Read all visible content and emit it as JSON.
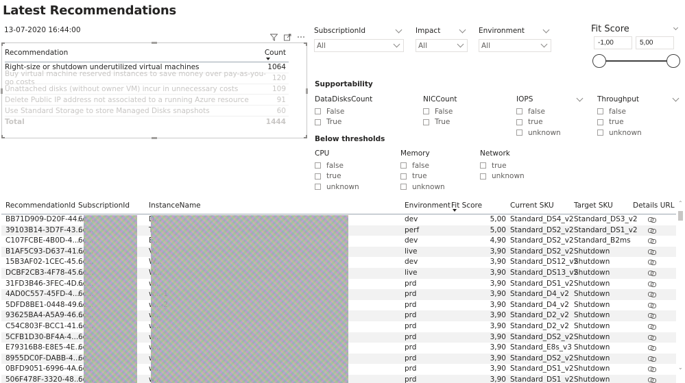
{
  "title": "Latest Recommendations",
  "timestamp": "13-07-2020 16:44:00",
  "visual_header_icons": [
    "filter-icon",
    "focus-mode-icon",
    "more-options-icon"
  ],
  "recommendations": {
    "columns": [
      "Recommendation",
      "Count"
    ],
    "sorted_by": "Count",
    "rows": [
      {
        "label": "Right-size or shutdown underutilized virtual machines",
        "count": "1064",
        "selected": true
      },
      {
        "label": "Buy virtual machine reserved instances to save money over pay-as-you-go costs",
        "count": "120",
        "selected": false
      },
      {
        "label": "Unattached disks (without owner VM) incur in unnecessary costs",
        "count": "109",
        "selected": false
      },
      {
        "label": "Delete Public IP address not associated to a running Azure resource",
        "count": "91",
        "selected": false
      },
      {
        "label": "Use Standard Storage to store Managed Disks snapshots",
        "count": "60",
        "selected": false
      }
    ],
    "total_label": "Total",
    "total": "1444"
  },
  "slicers": {
    "subscription": {
      "label": "SubscriptionId",
      "value": "All"
    },
    "impact": {
      "label": "Impact",
      "value": "All"
    },
    "environment": {
      "label": "Environment",
      "value": "All"
    },
    "fit_score": {
      "label": "Fit Score",
      "min": "-1,00",
      "max": "5,00",
      "range_selected": [
        -1.0,
        5.0
      ]
    }
  },
  "supportability": {
    "title": "Supportability",
    "groups": [
      {
        "label": "DataDisksCount",
        "options": [
          "False",
          "True"
        ],
        "has_chevron": false
      },
      {
        "label": "NICCount",
        "options": [
          "False",
          "True"
        ],
        "has_chevron": false
      },
      {
        "label": "IOPS",
        "options": [
          "false",
          "true",
          "unknown"
        ],
        "has_chevron": true
      },
      {
        "label": "Throughput",
        "options": [
          "false",
          "true",
          "unknown"
        ],
        "has_chevron": true
      }
    ]
  },
  "below_thresholds": {
    "title": "Below thresholds",
    "groups": [
      {
        "label": "CPU",
        "options": [
          "false",
          "true",
          "unknown"
        ]
      },
      {
        "label": "Memory",
        "options": [
          "false",
          "true",
          "unknown"
        ]
      },
      {
        "label": "Network",
        "options": [
          "true",
          "unknown"
        ]
      }
    ]
  },
  "grid": {
    "columns": [
      "RecommendationId",
      "SubscriptionId",
      "InstanceName",
      "Environment",
      "Fit Score",
      "Current SKU",
      "Target SKU",
      "Details URL"
    ],
    "sorted_by": "Fit Score",
    "rows": [
      {
        "id": "BB71D909-D20F-44...",
        "sub": "6c...",
        "inst": "D...",
        "env": "dev",
        "fit": "5,00",
        "cur": "Standard_DS4_v2",
        "tgt": "Standard_DS3_v2"
      },
      {
        "id": "39103B14-3D7F-43...",
        "sub": "6c...",
        "inst": "T...",
        "env": "perf",
        "fit": "5,00",
        "cur": "Standard_DS2_v2",
        "tgt": "Standard_DS1_v2"
      },
      {
        "id": "C107FCBE-4B0D-4...",
        "sub": "6c...",
        "inst": "E...",
        "env": "dev",
        "fit": "4,90",
        "cur": "Standard_DS2_v2",
        "tgt": "Standard_B2ms"
      },
      {
        "id": "B1AF5C93-D637-41...",
        "sub": "6c...",
        "inst": "V...",
        "env": "live",
        "fit": "3,90",
        "cur": "Standard_DS2_v2",
        "tgt": "Shutdown"
      },
      {
        "id": "15B3AF02-1CEC-45...",
        "sub": "6c...",
        "inst": "W...",
        "env": "dev",
        "fit": "3,90",
        "cur": "Standard_DS12_v2",
        "tgt": "Shutdown"
      },
      {
        "id": "DCBF2CB3-4F78-45...",
        "sub": "6c...",
        "inst": "W...",
        "env": "live",
        "fit": "3,90",
        "cur": "Standard_DS13_v2",
        "tgt": "Shutdown"
      },
      {
        "id": "31FD3B46-3FEC-4D...",
        "sub": "6c...",
        "inst": "w...",
        "env": "prd",
        "fit": "3,90",
        "cur": "Standard_DS1_v2",
        "tgt": "Shutdown"
      },
      {
        "id": "4AD0C557-45FD-4...",
        "sub": "6c...",
        "inst": "w...-1",
        "env": "prd",
        "fit": "3,90",
        "cur": "Standard_D4_v2",
        "tgt": "Shutdown"
      },
      {
        "id": "5DFD8BE1-0448-49...",
        "sub": "6c...",
        "inst": "w...-2",
        "env": "prd",
        "fit": "3,90",
        "cur": "Standard_D4_v2",
        "tgt": "Shutdown"
      },
      {
        "id": "93625BA4-A5A9-46...",
        "sub": "6c...",
        "inst": "w...",
        "env": "prd",
        "fit": "3,90",
        "cur": "Standard_D2_v2",
        "tgt": "Shutdown"
      },
      {
        "id": "C54C803F-BCC1-41...",
        "sub": "6c...",
        "inst": "w...",
        "env": "prd",
        "fit": "3,90",
        "cur": "Standard_D2_v2",
        "tgt": "Shutdown"
      },
      {
        "id": "5CFB1D30-BF4A-4...",
        "sub": "6c...",
        "inst": "w...",
        "env": "prd",
        "fit": "3,90",
        "cur": "Standard_DS2_v2",
        "tgt": "Shutdown"
      },
      {
        "id": "E79316B8-E8E5-4E...",
        "sub": "6c...",
        "inst": "w...",
        "env": "prd",
        "fit": "3,90",
        "cur": "Standard_E8s_v3",
        "tgt": "Shutdown"
      },
      {
        "id": "8955DC0F-DABB-4...",
        "sub": "6c...",
        "inst": "w...",
        "env": "prd",
        "fit": "3,90",
        "cur": "Standard_DS2_v2",
        "tgt": "Shutdown"
      },
      {
        "id": "0BFD9051-6996-4A...",
        "sub": "6c...",
        "inst": "w...",
        "env": "prd",
        "fit": "3,90",
        "cur": "Standard_DS1_v2",
        "tgt": "Shutdown"
      },
      {
        "id": "506F478F-3320-48...",
        "sub": "6c...",
        "inst": "w...",
        "env": "prd",
        "fit": "3,90",
        "cur": "Standard_DS1_v2",
        "tgt": "Shutdown"
      }
    ],
    "details_icon": "link-icon"
  }
}
